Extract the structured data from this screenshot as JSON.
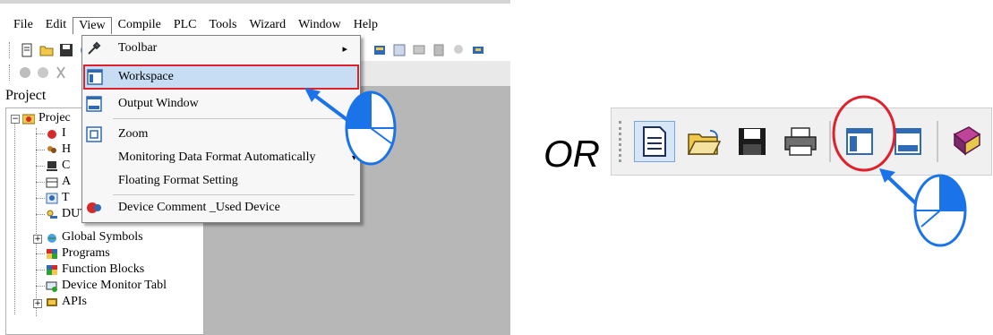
{
  "menubar": {
    "items": [
      "File",
      "Edit",
      "View",
      "Compile",
      "PLC",
      "Tools",
      "Wizard",
      "Window",
      "Help"
    ],
    "active": "View"
  },
  "project_panel": {
    "label": "Project",
    "tree": [
      {
        "text": "Projec",
        "level": 0
      },
      {
        "text": "I",
        "level": 1
      },
      {
        "text": "H",
        "level": 1
      },
      {
        "text": "C",
        "level": 1
      },
      {
        "text": "A",
        "level": 1
      },
      {
        "text": "T",
        "level": 1
      },
      {
        "text": "DUT",
        "level": 1
      },
      {
        "text": "Global Symbols",
        "level": 1
      },
      {
        "text": "Programs",
        "level": 1
      },
      {
        "text": "Function Blocks",
        "level": 1
      },
      {
        "text": "Device Monitor Tabl",
        "level": 1
      },
      {
        "text": "APIs",
        "level": 1
      }
    ]
  },
  "view_menu": {
    "items": [
      {
        "label": "Toolbar",
        "submenu": "▸",
        "icon": "tools-icon"
      },
      {
        "label": "Workspace",
        "icon": "workspace-icon",
        "highlighted": true
      },
      {
        "label": "Output Window",
        "icon": "output-window-icon"
      },
      {
        "label": "Zoom",
        "icon": "zoom-icon"
      },
      {
        "label": "Monitoring Data Format  Automatically",
        "submenu": "▾",
        "icon": ""
      },
      {
        "label": "Floating Format Setting",
        "icon": ""
      },
      {
        "label": "Device Comment _Used Device",
        "icon": "device-comment-icon"
      }
    ]
  },
  "or_text": "OR",
  "big_toolbar": {
    "icons": [
      "new-file-icon",
      "open-folder-icon",
      "save-icon",
      "print-icon",
      "workspace-icon",
      "output-window-icon",
      "help-book-icon"
    ],
    "circled": "workspace-icon"
  },
  "colors": {
    "highlight_fill": "#c6ddf4",
    "highlight_border": "#e0202a",
    "annotation_blue": "#1a73e8",
    "circle_red": "#e0202a"
  }
}
